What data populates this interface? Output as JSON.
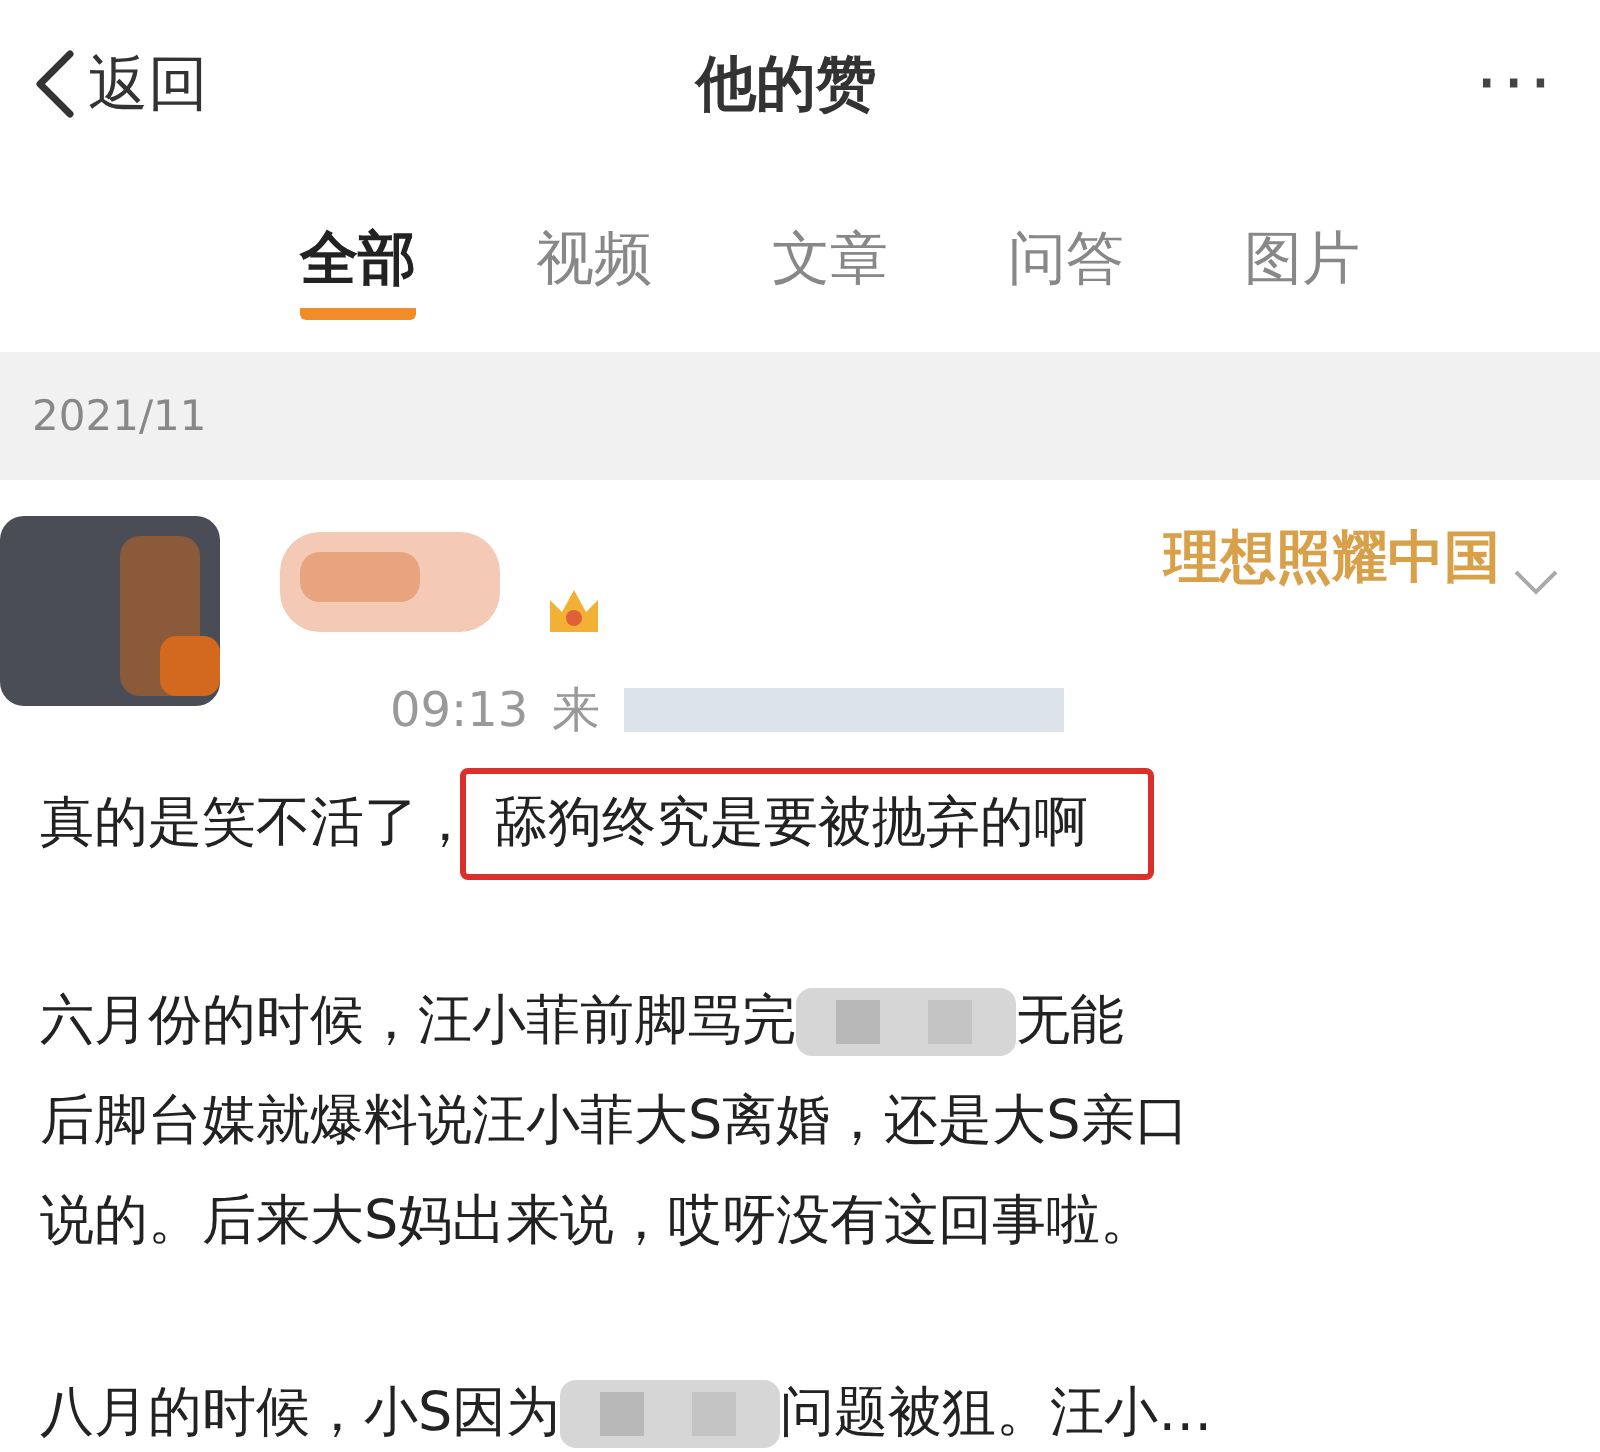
{
  "header": {
    "back_label": "返回",
    "title": "他的赞",
    "more": "···"
  },
  "tabs": [
    {
      "label": "全部",
      "selected": true
    },
    {
      "label": "视频",
      "selected": false
    },
    {
      "label": "文章",
      "selected": false
    },
    {
      "label": "问答",
      "selected": false
    },
    {
      "label": "图片",
      "selected": false
    }
  ],
  "date_section": "2021/11",
  "post": {
    "badge": "理想照耀中国",
    "time": "09:13",
    "source_prefix": "来",
    "paragraphs": [
      [
        [
          {
            "kind": "text",
            "text": "真的是笑不活了，"
          },
          {
            "kind": "boxed",
            "text": "舔狗终究是要被抛弃的啊"
          }
        ]
      ],
      [
        [
          {
            "kind": "text",
            "text": "六月份的时候，汪小菲前脚骂完"
          },
          {
            "kind": "redacted"
          },
          {
            "kind": "text",
            "text": "无能"
          }
        ],
        [
          {
            "kind": "text",
            "text": "后脚台媒就爆料说汪小菲大S离婚，还是大S亲口"
          }
        ],
        [
          {
            "kind": "text",
            "text": "说的。后来大S妈出来说，哎呀没有这回事啦。"
          }
        ]
      ],
      [
        [
          {
            "kind": "text",
            "text": "八月的时候，小S因为"
          },
          {
            "kind": "redacted"
          },
          {
            "kind": "text",
            "text": "问题被狙。汪小…"
          }
        ]
      ]
    ]
  }
}
